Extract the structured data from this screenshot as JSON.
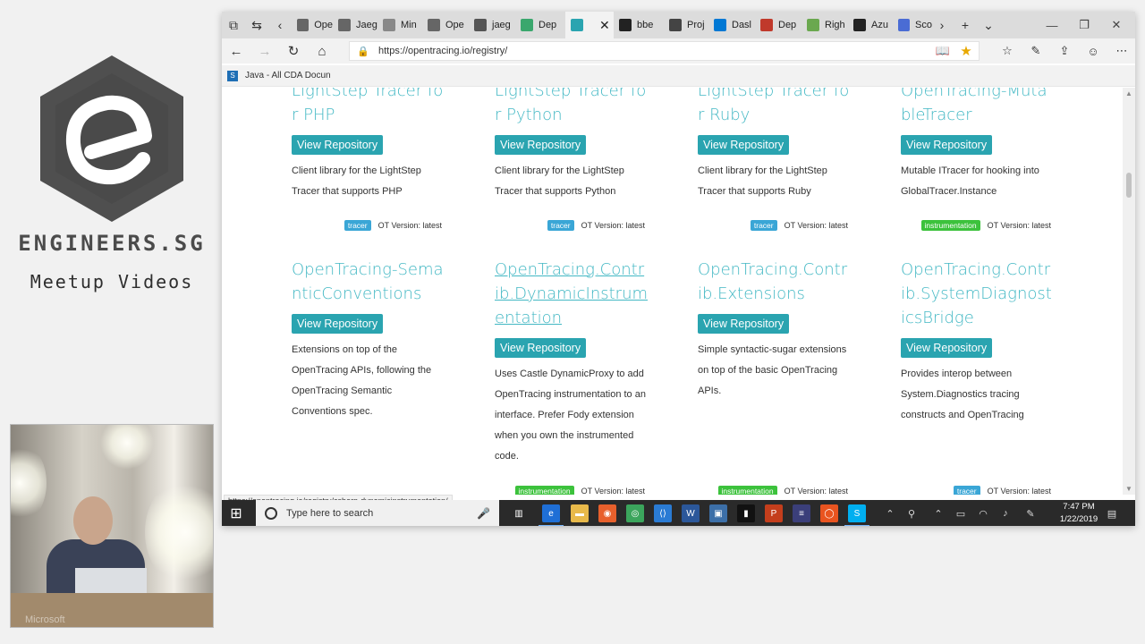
{
  "brand": {
    "title": "ENGINEERS.SG",
    "subtitle": "Meetup Videos",
    "video_watermark": "Microsoft"
  },
  "browser": {
    "tabs": [
      {
        "label": "Ope",
        "icon": "page-icon",
        "color": "#666666"
      },
      {
        "label": "Jaeg",
        "icon": "page-icon",
        "color": "#666666"
      },
      {
        "label": "Min",
        "icon": "image-icon",
        "color": "#888888"
      },
      {
        "label": "Ope",
        "icon": "page-icon",
        "color": "#666666"
      },
      {
        "label": "jaeg",
        "icon": "jaeger-icon",
        "color": "#555555"
      },
      {
        "label": "Dep",
        "icon": "dependency-icon",
        "color": "#3aa76d"
      },
      {
        "label": "",
        "icon": "opentracing-icon",
        "color": "#2aa4b0",
        "active": true
      },
      {
        "label": "bbe",
        "icon": "github-icon",
        "color": "#222222"
      },
      {
        "label": "Proj",
        "icon": "project-icon",
        "color": "#444444"
      },
      {
        "label": "Dasl",
        "icon": "azure-icon",
        "color": "#0078d4"
      },
      {
        "label": "Dep",
        "icon": "deploy-icon",
        "color": "#c0392b"
      },
      {
        "label": "Righ",
        "icon": "right-icon",
        "color": "#6aa84f"
      },
      {
        "label": "Azu",
        "icon": "github-icon",
        "color": "#222222"
      },
      {
        "label": "Sco",
        "icon": "vs-icon",
        "color": "#4a6cd4"
      }
    ],
    "url": "https://opentracing.io/registry/",
    "favorite": "Java - All CDA Docun",
    "status_url": "https://opentracing.io/registry/csharp-dynamicinstrumentation/"
  },
  "registry": {
    "button_label": "View Repository",
    "version_label": "OT Version: latest",
    "cards": [
      {
        "title": "LightStep Tracer for PHP",
        "desc": "Client library for the LightStep Tracer that supports PHP",
        "tag": "tracer"
      },
      {
        "title": "LightStep Tracer for Python",
        "desc": "Client library for the LightStep Tracer that supports Python",
        "tag": "tracer"
      },
      {
        "title": "LightStep Tracer for Ruby",
        "desc": "Client library for the LightStep Tracer that supports Ruby",
        "tag": "tracer"
      },
      {
        "title": "OpenTracing-MutableTracer",
        "desc": "Mutable ITracer for hooking into GlobalTracer.Instance",
        "tag": "instrumentation"
      },
      {
        "title": "OpenTracing-SemanticConventions",
        "desc": "Extensions on top of the OpenTracing APIs, following the OpenTracing Semantic Conventions spec.",
        "tag": ""
      },
      {
        "title": "OpenTracing.Contrib.DynamicInstrumentation",
        "desc": "Uses Castle DynamicProxy to add OpenTracing instrumentation to an interface. Prefer Fody extension when you own the instrumented code.",
        "tag": "instrumentation"
      },
      {
        "title": "OpenTracing.Contrib.Extensions",
        "desc": "Simple syntactic-sugar extensions on top of the basic OpenTracing APIs.",
        "tag": "instrumentation"
      },
      {
        "title": "OpenTracing.Contrib.SystemDiagnosticsBridge",
        "desc": "Provides interop between System.Diagnostics tracing constructs and OpenTracing",
        "tag": "tracer"
      }
    ]
  },
  "taskbar": {
    "search_placeholder": "Type here to search",
    "time": "7:47 PM",
    "date": "1/22/2019",
    "apps": [
      {
        "icon": "task-view-icon",
        "color": "#2a2a2a"
      },
      {
        "icon": "edge-icon",
        "color": "#1f6fd6"
      },
      {
        "icon": "file-explorer-icon",
        "color": "#e8b94a"
      },
      {
        "icon": "firefox-icon",
        "color": "#e8602c"
      },
      {
        "icon": "chrome-icon",
        "color": "#3ba55c"
      },
      {
        "icon": "vscode-icon",
        "color": "#2a7bd4"
      },
      {
        "icon": "word-icon",
        "color": "#2b579a"
      },
      {
        "icon": "app-icon",
        "color": "#3c6fa8"
      },
      {
        "icon": "terminal-icon",
        "color": "#111111"
      },
      {
        "icon": "powerpoint-icon",
        "color": "#c43e1c"
      },
      {
        "icon": "eclipse-icon",
        "color": "#3b3f7a"
      },
      {
        "icon": "ubuntu-icon",
        "color": "#e95420"
      },
      {
        "icon": "skype-icon",
        "color": "#00aff0"
      }
    ]
  }
}
